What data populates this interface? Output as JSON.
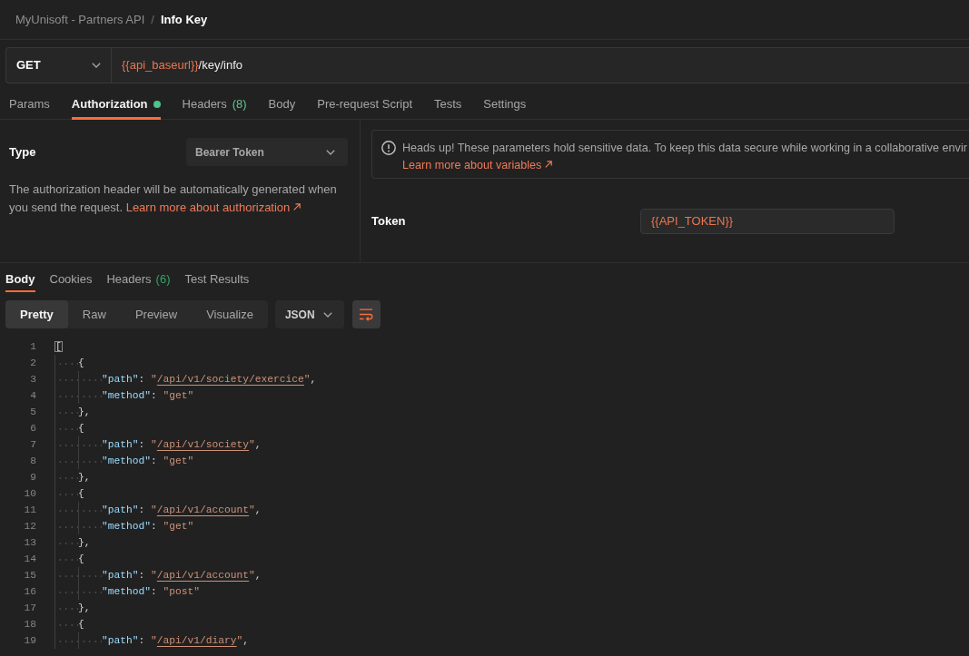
{
  "breadcrumb": {
    "collection": "MyUnisoft - Partners API",
    "separator": "/",
    "request": "Info Key"
  },
  "request": {
    "method": "GET",
    "url": [
      {
        "kind": "variable",
        "text": "{{api_baseurl}}"
      },
      {
        "kind": "plain",
        "text": "/key/info"
      }
    ]
  },
  "request_tabs": [
    {
      "label": "Params",
      "selected": false,
      "dot": false
    },
    {
      "label": "Authorization",
      "selected": true,
      "dot": true
    },
    {
      "label": "Headers",
      "count": "(8)",
      "selected": false,
      "dot": false
    },
    {
      "label": "Body",
      "selected": false,
      "dot": false
    },
    {
      "label": "Pre-request Script",
      "selected": false,
      "dot": false
    },
    {
      "label": "Tests",
      "selected": false,
      "dot": false
    },
    {
      "label": "Settings",
      "selected": false,
      "dot": false
    }
  ],
  "authorization": {
    "type_label": "Type",
    "type_value": "Bearer Token",
    "description": "The authorization header will be automatically generated when you send the request.",
    "description_link": "Learn more about authorization",
    "notice": {
      "text": "Heads up! These parameters hold sensitive data. To keep this data secure while working in a collaborative envir",
      "link": "Learn more about variables"
    },
    "token_label": "Token",
    "token_value": "{{API_TOKEN}}"
  },
  "response_tabs": [
    {
      "label": "Body",
      "selected": true
    },
    {
      "label": "Cookies",
      "selected": false
    },
    {
      "label": "Headers",
      "count": "(6)",
      "selected": false
    },
    {
      "label": "Test Results",
      "selected": false
    }
  ],
  "view_modes": [
    {
      "label": "Pretty",
      "selected": true
    },
    {
      "label": "Raw",
      "selected": false
    },
    {
      "label": "Preview",
      "selected": false
    },
    {
      "label": "Visualize",
      "selected": false
    }
  ],
  "format": "JSON",
  "wrap_lines": {
    "on": true
  },
  "code_lines": [
    {
      "number": "1",
      "tokens": [
        {
          "kind": "match",
          "text": "["
        }
      ],
      "children": [
        {
          "number": "2",
          "tokens": [
            {
              "kind": "punct",
              "text": "{"
            }
          ],
          "children": [
            {
              "number": "3",
              "tokens": [
                {
                  "kind": "key",
                  "text": "\"path\""
                },
                {
                  "kind": "punct",
                  "text": ": "
                },
                {
                  "kind": "string",
                  "text": "\""
                },
                {
                  "kind": "link",
                  "text": "/api/v1/society/exercice"
                },
                {
                  "kind": "string",
                  "text": "\""
                },
                {
                  "kind": "punct",
                  "text": ","
                }
              ]
            },
            {
              "number": "4",
              "tokens": [
                {
                  "kind": "key",
                  "text": "\"method\""
                },
                {
                  "kind": "punct",
                  "text": ": "
                },
                {
                  "kind": "string",
                  "text": "\"get\""
                }
              ]
            }
          ]
        },
        {
          "number": "5",
          "tokens": [
            {
              "kind": "punct",
              "text": "},"
            }
          ]
        },
        {
          "number": "6",
          "tokens": [
            {
              "kind": "punct",
              "text": "{"
            }
          ],
          "children": [
            {
              "number": "7",
              "tokens": [
                {
                  "kind": "key",
                  "text": "\"path\""
                },
                {
                  "kind": "punct",
                  "text": ": "
                },
                {
                  "kind": "string",
                  "text": "\""
                },
                {
                  "kind": "link",
                  "text": "/api/v1/society"
                },
                {
                  "kind": "string",
                  "text": "\""
                },
                {
                  "kind": "punct",
                  "text": ","
                }
              ]
            },
            {
              "number": "8",
              "tokens": [
                {
                  "kind": "key",
                  "text": "\"method\""
                },
                {
                  "kind": "punct",
                  "text": ": "
                },
                {
                  "kind": "string",
                  "text": "\"get\""
                }
              ]
            }
          ]
        },
        {
          "number": "9",
          "tokens": [
            {
              "kind": "punct",
              "text": "},"
            }
          ]
        },
        {
          "number": "10",
          "tokens": [
            {
              "kind": "punct",
              "text": "{"
            }
          ],
          "children": [
            {
              "number": "11",
              "tokens": [
                {
                  "kind": "key",
                  "text": "\"path\""
                },
                {
                  "kind": "punct",
                  "text": ": "
                },
                {
                  "kind": "string",
                  "text": "\""
                },
                {
                  "kind": "link",
                  "text": "/api/v1/account"
                },
                {
                  "kind": "string",
                  "text": "\""
                },
                {
                  "kind": "punct",
                  "text": ","
                }
              ]
            },
            {
              "number": "12",
              "tokens": [
                {
                  "kind": "key",
                  "text": "\"method\""
                },
                {
                  "kind": "punct",
                  "text": ": "
                },
                {
                  "kind": "string",
                  "text": "\"get\""
                }
              ]
            }
          ]
        },
        {
          "number": "13",
          "tokens": [
            {
              "kind": "punct",
              "text": "},"
            }
          ]
        },
        {
          "number": "14",
          "tokens": [
            {
              "kind": "punct",
              "text": "{"
            }
          ],
          "children": [
            {
              "number": "15",
              "tokens": [
                {
                  "kind": "key",
                  "text": "\"path\""
                },
                {
                  "kind": "punct",
                  "text": ": "
                },
                {
                  "kind": "string",
                  "text": "\""
                },
                {
                  "kind": "link",
                  "text": "/api/v1/account"
                },
                {
                  "kind": "string",
                  "text": "\""
                },
                {
                  "kind": "punct",
                  "text": ","
                }
              ]
            },
            {
              "number": "16",
              "tokens": [
                {
                  "kind": "key",
                  "text": "\"method\""
                },
                {
                  "kind": "punct",
                  "text": ": "
                },
                {
                  "kind": "string",
                  "text": "\"post\""
                }
              ]
            }
          ]
        },
        {
          "number": "17",
          "tokens": [
            {
              "kind": "punct",
              "text": "},"
            }
          ]
        },
        {
          "number": "18",
          "tokens": [
            {
              "kind": "punct",
              "text": "{"
            }
          ],
          "children": [
            {
              "number": "19",
              "tokens": [
                {
                  "kind": "key",
                  "text": "\"path\""
                },
                {
                  "kind": "punct",
                  "text": ": "
                },
                {
                  "kind": "string",
                  "text": "\""
                },
                {
                  "kind": "link",
                  "text": "/api/v1/diary"
                },
                {
                  "kind": "string",
                  "text": "\""
                },
                {
                  "kind": "punct",
                  "text": ","
                }
              ]
            }
          ]
        }
      ]
    }
  ]
}
